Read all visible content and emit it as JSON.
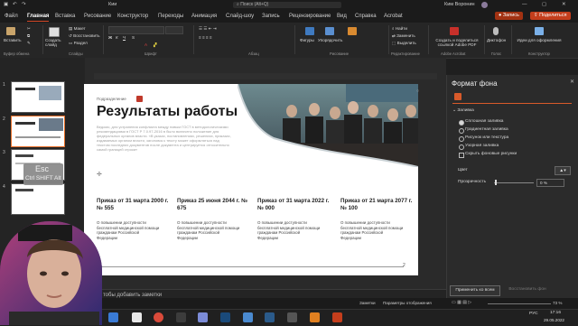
{
  "titlebar": {
    "app": "Кии",
    "search": "Поиск (Alt+Q)",
    "user": "Ким Воронин"
  },
  "tabs": [
    "Файл",
    "Главная",
    "Вставка",
    "Рисование",
    "Конструктор",
    "Переходы",
    "Анимация",
    "Слайд-шоу",
    "Запись",
    "Рецензирование",
    "Вид",
    "Справка",
    "Acrobat"
  ],
  "actions": {
    "record": "Запись",
    "share": "Поделиться"
  },
  "ribbon": {
    "paste": "Вставить",
    "clipboard": "Буфер обмена",
    "create_slide": "Создать слайд",
    "layout": "Макет",
    "reset": "Восстановить",
    "section": "Раздел",
    "slides": "Слайды",
    "font": "Шрифт",
    "paragraph": "Абзац",
    "shapes": "Фигуры",
    "arrange": "Упорядочить",
    "drawing": "Рисование",
    "find": "Найти",
    "replace": "Заменить",
    "select": "Выделить",
    "editing": "Редактирование",
    "acrobat_share": "Создать и поделиться ссылкой Adobe PDF",
    "adobe": "Adobe Acrobat",
    "dictate": "Диктофон",
    "voice": "Голос",
    "designer": "Идеи для оформления",
    "designer_group": "Конструктор"
  },
  "thumbs": {
    "numbers": [
      "1",
      "2",
      "3",
      "4"
    ],
    "esc_keys": "Esc",
    "key_line": "Ctrl SHIFT Alt"
  },
  "slide": {
    "section_label": "Подразделение",
    "title": "Результаты работы",
    "body": "Ведомо, для устранения конфликта между новым ГОСТ в методологическими рекомендациями в ГОСТ Р 7.0.97-2016 в было включено положение для федеральных органов власти. «В указах, постановлениях, решениях, приказах, издаваемых органом власти, заголовок к тексту может оформляться над текстом последних документов после документа и центрируется относительно самой границей строки»",
    "orders": [
      {
        "title": "Приказ от 31 марта 2000 г. № 555",
        "desc": "О повышении доступности бесплатной медицинской помощи гражданам Российской Федерации"
      },
      {
        "title": "Приказ 25 июня 2044 г. № 675",
        "desc": "О повышении доступности бесплатной медицинской помощи гражданам Российской Федерации"
      },
      {
        "title": "Приказ от 31 марта 2022 г. № 000",
        "desc": "О повышении доступности бесплатной медицинской помощи гражданам Российской Федерации"
      },
      {
        "title": "Приказ от 21 марта 2077 г. № 100",
        "desc": "О повышении доступности бесплатной медицинской помощи гражданам Российской Федерации"
      }
    ],
    "page_number": "2"
  },
  "notes_placeholder": "тобы добавить заметки",
  "pane": {
    "title": "Формат фона",
    "section": "Заливка",
    "options": [
      "Сплошная заливка",
      "Градиентная заливка",
      "Рисунок или текстура",
      "Узорная заливка",
      "Скрыть фоновые рисунки"
    ],
    "selected": 0,
    "color_label": "Цвет",
    "transparency_label": "Прозрачность",
    "transparency_value": "0 %",
    "apply_all": "Применить ко всем",
    "reset_bg": "Восстановить фон"
  },
  "status": {
    "slide": "Слайд 2 из 5",
    "notes": "Заметки",
    "display": "Параметры отображения",
    "zoom": "73 %"
  },
  "taskbar": {
    "lang": "РУС",
    "time": "17:16",
    "date": "29.05.2022"
  },
  "colors": {
    "accent": "#d24726",
    "share": "#c43e1c",
    "record": "#a23212"
  }
}
